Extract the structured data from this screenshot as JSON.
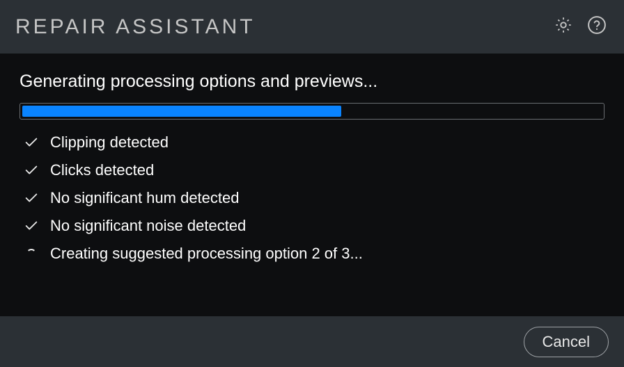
{
  "titlebar": {
    "title": "REPAIR ASSISTANT"
  },
  "main": {
    "status_heading": "Generating processing options and previews...",
    "progress_percent": 55,
    "steps": [
      {
        "icon": "check",
        "text": "Clipping detected"
      },
      {
        "icon": "check",
        "text": "Clicks detected"
      },
      {
        "icon": "check",
        "text": "No significant hum detected"
      },
      {
        "icon": "check",
        "text": "No significant noise detected"
      },
      {
        "icon": "spinner",
        "text": "Creating suggested processing option 2 of 3..."
      }
    ]
  },
  "footer": {
    "cancel_label": "Cancel"
  }
}
